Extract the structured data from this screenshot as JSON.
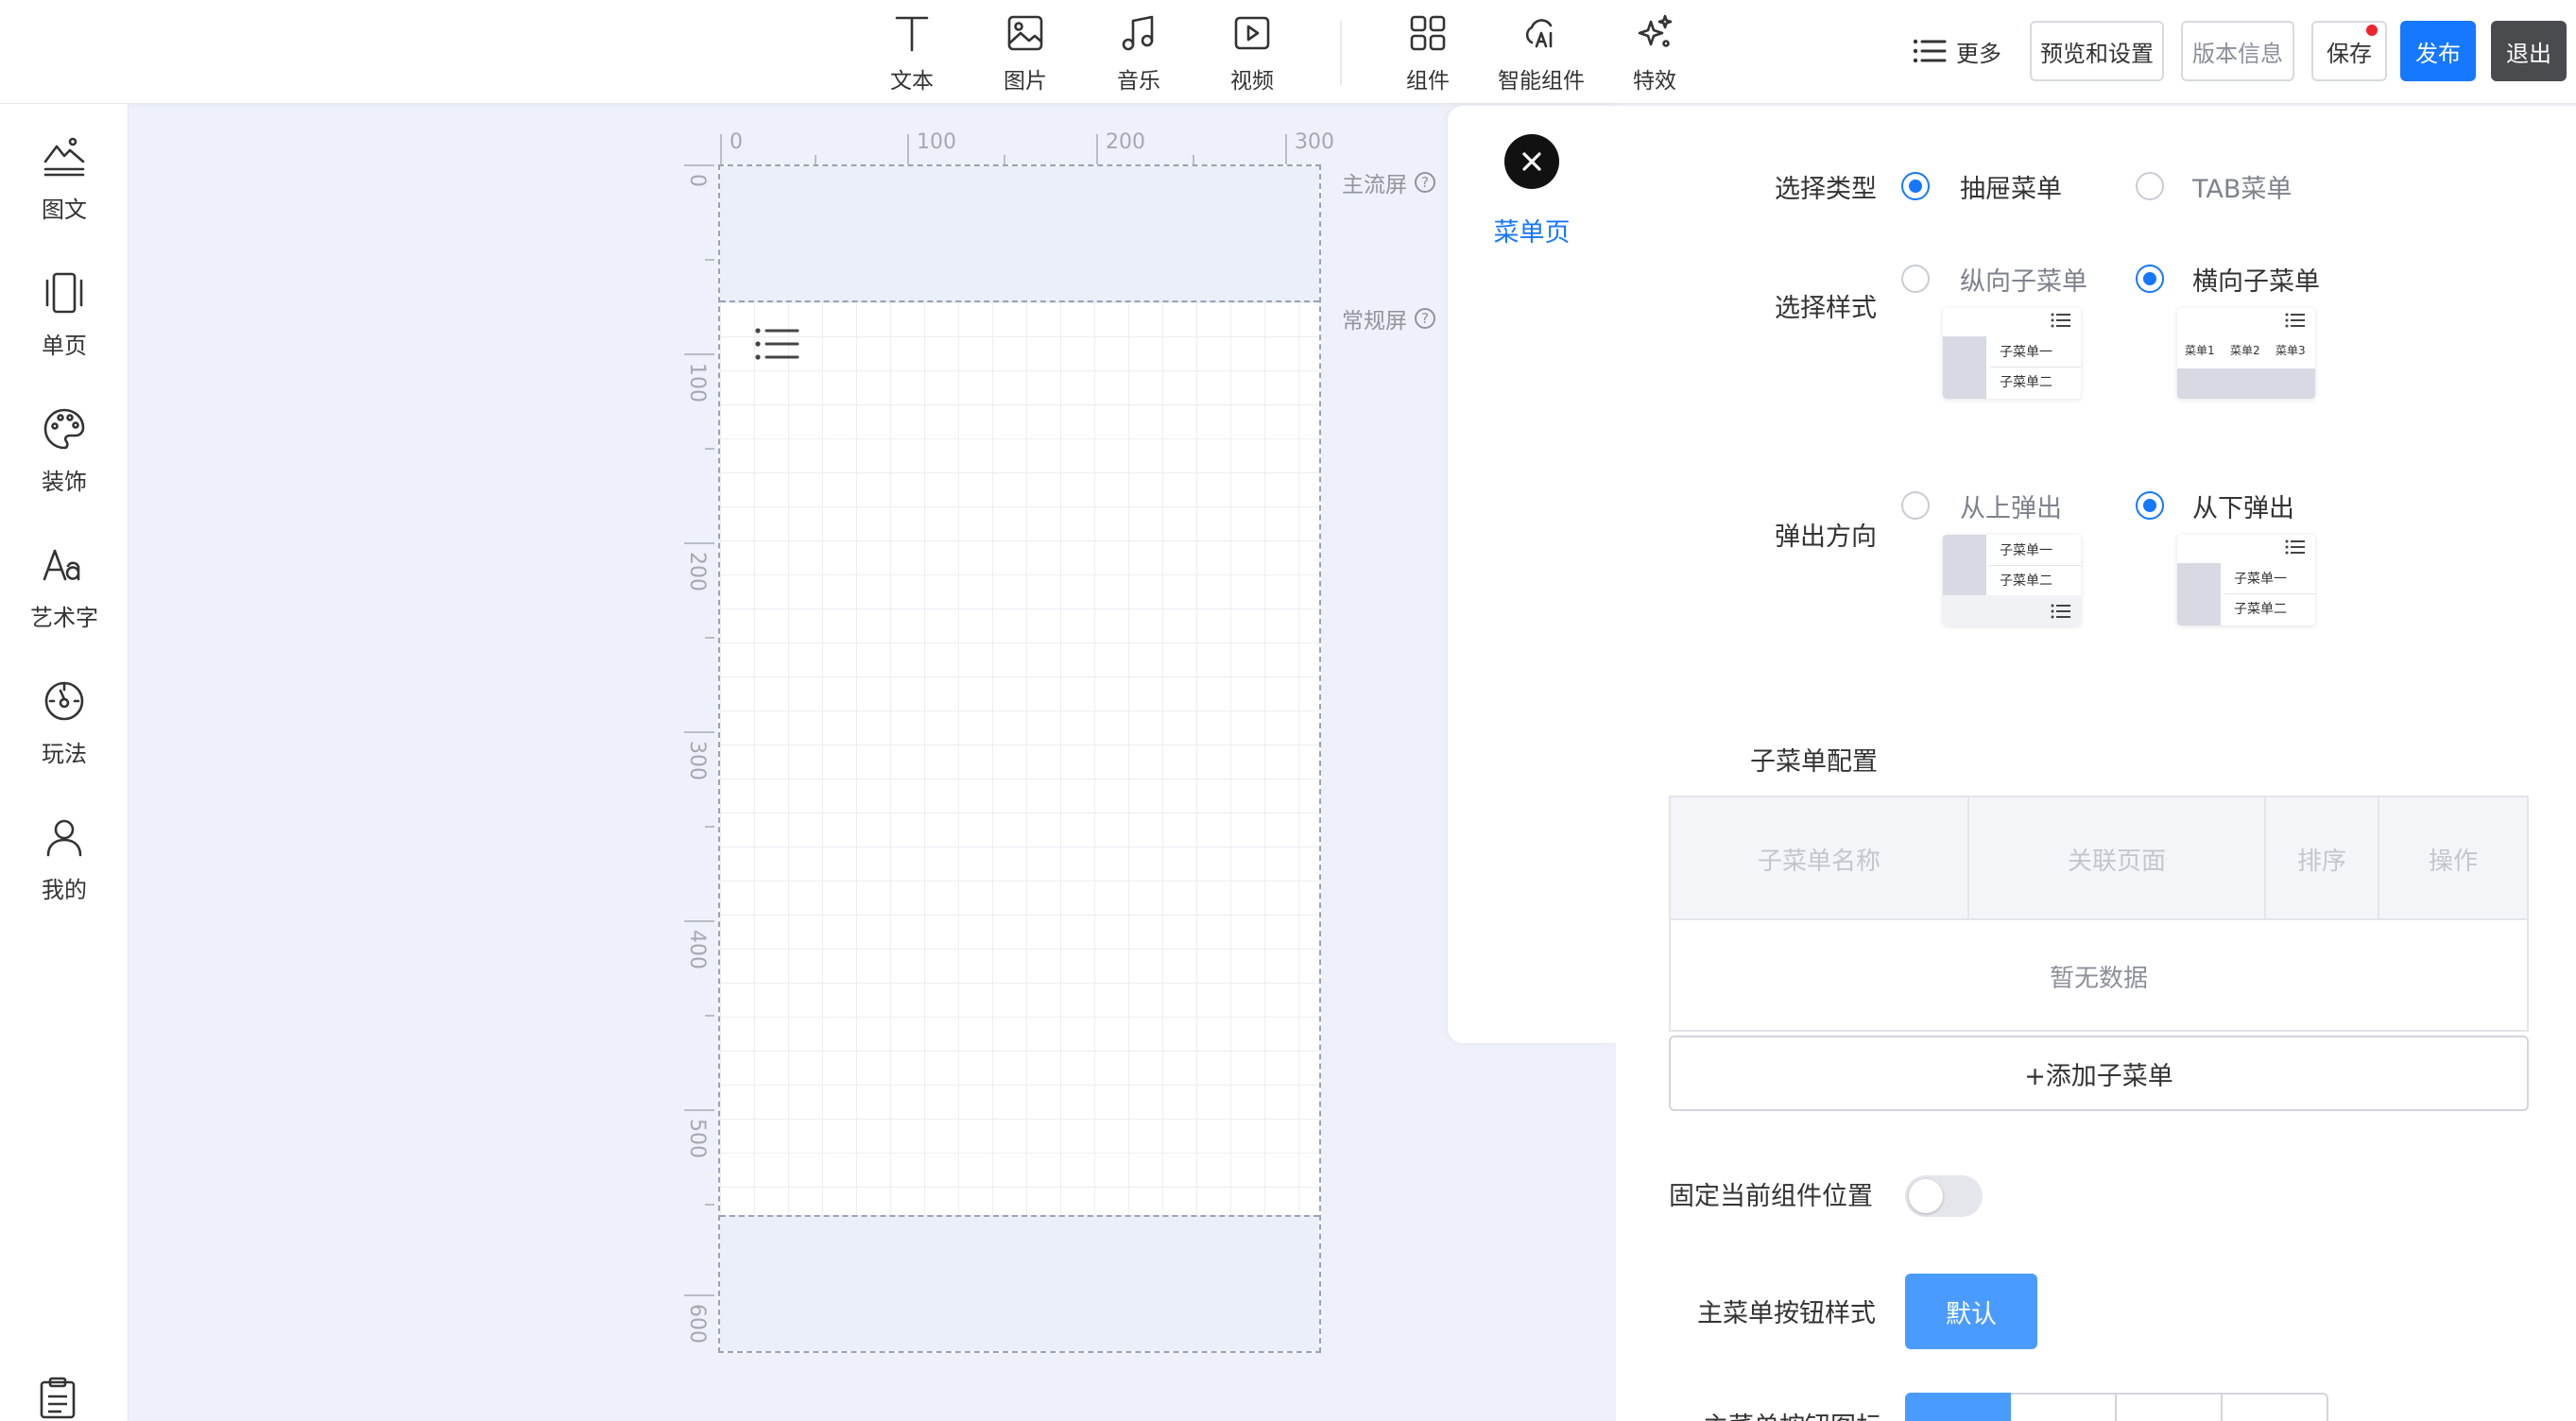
{
  "toolbar": {
    "tools": [
      {
        "label": "文本",
        "icon": "text-icon"
      },
      {
        "label": "图片",
        "icon": "image-icon"
      },
      {
        "label": "音乐",
        "icon": "music-icon"
      },
      {
        "label": "视频",
        "icon": "video-icon"
      },
      {
        "label": "组件",
        "icon": "components-icon"
      },
      {
        "label": "智能组件",
        "icon": "ai-components-icon"
      },
      {
        "label": "特效",
        "icon": "sparkle-icon"
      }
    ],
    "more_label": "更多",
    "preview_label": "预览和设置",
    "version_label": "版本信息",
    "save_label": "保存",
    "publish_label": "发布",
    "exit_label": "退出",
    "colors": {
      "primary": "#1677ff",
      "exit": "#4a4b4f",
      "dot": "#f0242f"
    }
  },
  "sidebar": {
    "items": [
      {
        "label": "图文",
        "icon": "image-text-icon"
      },
      {
        "label": "单页",
        "icon": "single-page-icon"
      },
      {
        "label": "装饰",
        "icon": "palette-icon"
      },
      {
        "label": "艺术字",
        "icon": "art-text-icon"
      },
      {
        "label": "玩法",
        "icon": "gameplay-icon"
      },
      {
        "label": "我的",
        "icon": "user-icon"
      }
    ],
    "bottom_icon": "clipboard-icon"
  },
  "canvas": {
    "ruler_top": [
      "0",
      "100",
      "200",
      "300"
    ],
    "ruler_left": [
      "0",
      "100",
      "200",
      "300",
      "400",
      "500",
      "600"
    ],
    "first_screen_label": "主流屏",
    "regular_screen_label": "常规屏",
    "help_glyph": "?"
  },
  "tabpanel": {
    "active_tab": "菜单页"
  },
  "props": {
    "type_label": "选择类型",
    "type_options": [
      "抽屉菜单",
      "TAB菜单"
    ],
    "style_label": "选择样式",
    "style_options": [
      "纵向子菜单",
      "横向子菜单"
    ],
    "direction_label": "弹出方向",
    "direction_options": [
      "从上弹出",
      "从下弹出"
    ],
    "thumb_text": {
      "sub1": "子菜单一",
      "sub2": "子菜单二",
      "m1": "菜单1",
      "m2": "菜单2",
      "m3": "菜单3"
    },
    "submenu_config_title": "子菜单配置",
    "table_headers": [
      "子菜单名称",
      "关联页面",
      "排序",
      "操作"
    ],
    "empty_text": "暂无数据",
    "add_button": "+添加子菜单",
    "fix_position_label": "固定当前组件位置",
    "button_style_label": "主菜单按钮样式",
    "default_button": "默认",
    "cut_label": "主菜单按钮图标"
  }
}
